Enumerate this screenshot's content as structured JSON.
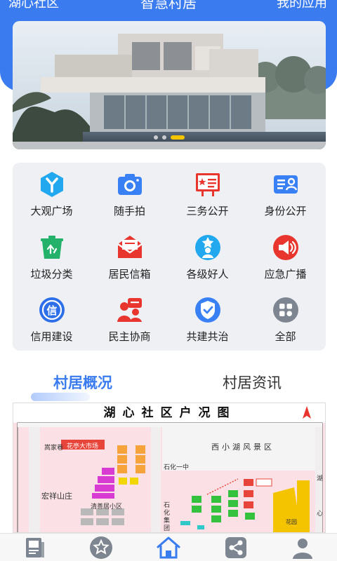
{
  "header": {
    "left_label": "湖心社区",
    "title": "智慧村居",
    "right_label": "我的应用"
  },
  "banner": {
    "slides": 3,
    "active_index": 2
  },
  "grid": {
    "items": [
      {
        "label": "大观广场",
        "icon": "tree-y-icon",
        "color": "#21a8ee"
      },
      {
        "label": "随手拍",
        "icon": "camera-icon",
        "color": "#3a80f5"
      },
      {
        "label": "三务公开",
        "icon": "notice-board-icon",
        "color": "#e8362e"
      },
      {
        "label": "身份公开",
        "icon": "id-card-icon",
        "color": "#3a80f5"
      },
      {
        "label": "垃圾分类",
        "icon": "recycle-bin-icon",
        "color": "#24b26b"
      },
      {
        "label": "居民信箱",
        "icon": "mailbox-icon",
        "color": "#e8362e"
      },
      {
        "label": "各级好人",
        "icon": "good-person-icon",
        "color": "#21a8ee"
      },
      {
        "label": "应急广播",
        "icon": "broadcast-icon",
        "color": "#e8362e"
      },
      {
        "label": "信用建设",
        "icon": "credit-icon",
        "color": "#2c6fe8"
      },
      {
        "label": "民主协商",
        "icon": "consultation-icon",
        "color": "#e8362e"
      },
      {
        "label": "共建共治",
        "icon": "shield-check-icon",
        "color": "#3a80f5"
      },
      {
        "label": "全部",
        "icon": "all-apps-icon",
        "color": "#7d8590"
      }
    ]
  },
  "tabs": {
    "active": "村居概况",
    "inactive": "村居资讯"
  },
  "map": {
    "title": "湖心社区户况图",
    "labels": {
      "market": "花亭大市场",
      "scenic": "西小湖风景区",
      "hongxiang": "宏祥山庄",
      "qingshan": "清善居小区",
      "shihua": "石化一中",
      "flower": "花园",
      "road_he": "湖",
      "road_xin": "心",
      "jiaoxue": "嵩家巷",
      "shihua_area": "石化集团区"
    }
  },
  "bottom_nav": {
    "items": [
      {
        "name": "news-icon"
      },
      {
        "name": "star-icon"
      },
      {
        "name": "home-icon",
        "active": true
      },
      {
        "name": "share-icon"
      },
      {
        "name": "profile-icon"
      }
    ]
  },
  "colors": {
    "brand": "#3a7cf0",
    "grid_bg": "#eef0f3"
  }
}
